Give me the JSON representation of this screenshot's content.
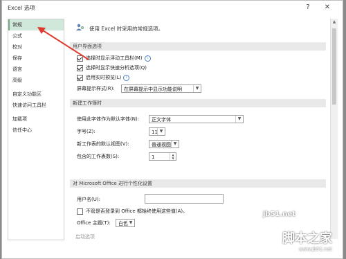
{
  "window": {
    "title": "Excel 选项",
    "help": "?",
    "close": "✕"
  },
  "sidebar": {
    "items": [
      {
        "label": "常规",
        "active": true
      },
      {
        "label": "公式"
      },
      {
        "label": "校对"
      },
      {
        "label": "保存"
      },
      {
        "label": "语言"
      },
      {
        "label": "高级"
      },
      {
        "label": "自定义功能区"
      },
      {
        "label": "快速访问工具栏"
      },
      {
        "label": "加载项"
      },
      {
        "label": "信任中心"
      }
    ]
  },
  "main": {
    "intro": "使用 Excel 时采用的常规选项。",
    "sections": {
      "ui": "用户界面选项",
      "new_wb": "新建工作簿时",
      "personal": "对 Microsoft Office 进行个性化设置",
      "startup": "启动选项"
    },
    "ui_options": {
      "mini_toolbar": "选择时显示浮动工具栏(M)",
      "quick_analysis": "选择时显示快速分析选项(Q)",
      "live_preview": "启用实时预览(L)",
      "screentip_label": "屏幕提示样式(R):",
      "screentip_value": "在屏幕提示中显示功能说明"
    },
    "new_workbook": {
      "font_label": "使用此字体作为默认字体(N):",
      "font_value": "正文字体",
      "size_label": "字号(Z):",
      "size_value": "11",
      "view_label": "新工作表的默认视图(V):",
      "view_value": "普通视图",
      "sheets_label": "包含的工作表数(S):",
      "sheets_value": "1"
    },
    "personalize": {
      "username_label": "用户名(U):",
      "always_use": "不管是否登录到 Office 都始终使用这些值(A)。",
      "theme_label": "Office 主题(T):",
      "theme_value": "白色"
    }
  },
  "watermark": {
    "line1": "jb51.net",
    "line2": "脚本之家",
    "line3": "www.jb51.net"
  },
  "colors": {
    "active_bg": "#cfe8da",
    "arrow": "#e03a2f",
    "section_bg": "#e9e9e9"
  }
}
